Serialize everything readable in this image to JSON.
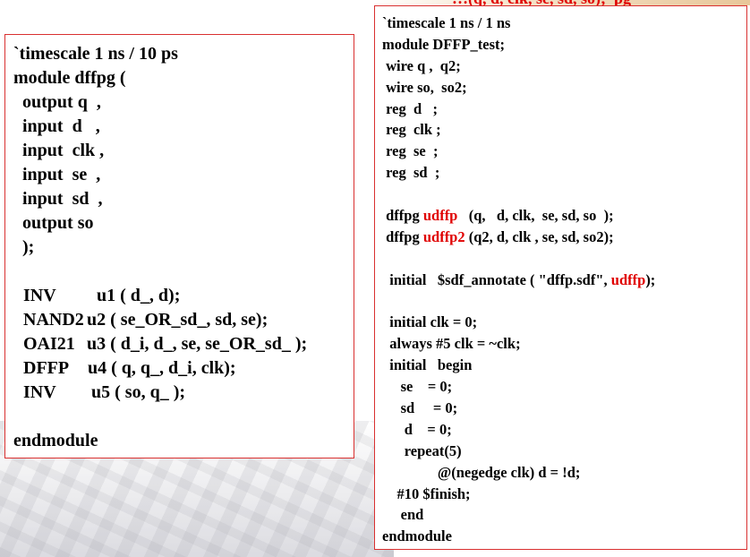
{
  "top_fragment": "…(q, d, clk, se, sd, so);  pg",
  "colors": {
    "highlight": "#e00000",
    "border": "#d93030"
  },
  "module_box": {
    "lines": [
      "`timescale 1 ns / 10 ps",
      "module dffpg (",
      "  output q  ,",
      "  input  d   ,",
      "  input  clk ,",
      "  input  se  ,",
      "  input  sd  ,",
      "  output so",
      "  );",
      "",
      "  INV",
      "  NAND2",
      "  OAI21",
      "  DFFP",
      "  INV",
      "",
      "endmodule"
    ],
    "instances": [
      {
        "cell": "INV",
        "rest": "u1 ( d_, d);"
      },
      {
        "cell": "NAND2",
        "rest": "u2 ( se_OR_sd_, sd, se);"
      },
      {
        "cell": "OAI21",
        "rest": "u3 ( d_i, d_, se, se_OR_sd_ );"
      },
      {
        "cell": "DFFP",
        "rest": "u4 ( q, q_, d_i, clk);"
      },
      {
        "cell": "INV",
        "rest": "u5 ( so, q_ );"
      }
    ]
  },
  "test_box": {
    "header": [
      "`timescale 1 ns / 1 ns",
      "module DFFP_test;",
      " wire q ,  q2;",
      " wire so,  so2;",
      " reg  d   ;",
      " reg  clk ;",
      " reg  se  ;",
      " reg  sd  ;"
    ],
    "inst1": {
      "pre": " dffpg ",
      "name": "udffp",
      "post": "   (q,   d, clk,  se, sd, so  );"
    },
    "inst2": {
      "pre": " dffpg ",
      "name": "udffp2",
      "post": " (q2, d, clk , se, sd, so2);"
    },
    "sdf": {
      "pre": "  initial   $sdf_annotate ( \"dffp.sdf\", ",
      "name": "udffp",
      "post": ");"
    },
    "body": [
      "  initial clk = 0;",
      "  always #5 clk = ~clk;",
      "  initial   begin",
      "     se    = 0;",
      "     sd     = 0;",
      "      d    = 0;",
      "      repeat(5)",
      "               @(negedge clk) d = !d;",
      "    #10 $finish;",
      "     end",
      "endmodule"
    ]
  }
}
